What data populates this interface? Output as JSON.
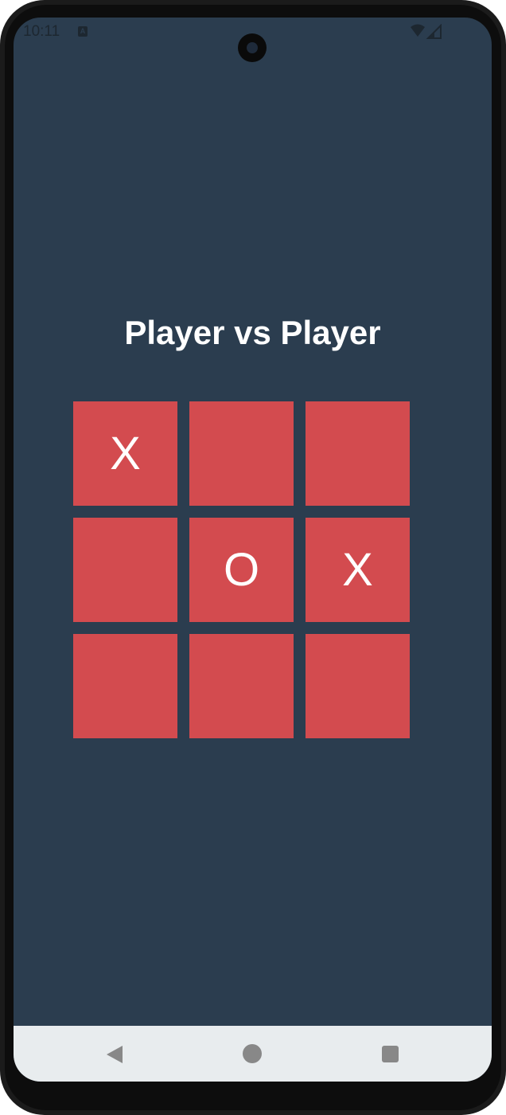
{
  "status_bar": {
    "time": "10:11",
    "notification_icon": "a-notification-icon",
    "wifi_icon": "wifi-icon",
    "signal_icon": "cellular-signal-icon"
  },
  "game": {
    "title": "Player vs Player",
    "board": [
      [
        "X",
        "",
        ""
      ],
      [
        "",
        "O",
        "X"
      ],
      [
        "",
        "",
        ""
      ]
    ]
  },
  "colors": {
    "background": "#2b3d4f",
    "cell": "#d34b4f",
    "mark": "#ffffff",
    "nav_bar": "#e8ecee"
  },
  "nav_bar": {
    "back_icon": "back-triangle-icon",
    "home_icon": "home-circle-icon",
    "recents_icon": "recents-square-icon"
  }
}
